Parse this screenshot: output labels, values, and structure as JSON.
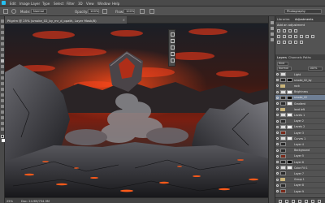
{
  "menubar": {
    "items": [
      "Edit",
      "Image",
      "Layer",
      "Type",
      "Select",
      "Filter",
      "3D",
      "View",
      "Window",
      "Help"
    ]
  },
  "options": {
    "opacity_label": "Opacity:",
    "opacity_value": "100%",
    "flow_label": "Flow:",
    "flow_value": "100%",
    "mode_label": "Mode:",
    "mode_value": "Normal",
    "workspace": "Photography"
  },
  "document": {
    "tab_title": "Pilgrim @ 25% (smoke_02_by_mr_d_opath, Layer Mask/8)",
    "zoom": "25%",
    "doc_size": "Doc: 24.9M/734.9M"
  },
  "right_panel": {
    "top_tabs": [
      "Libraries",
      "Adjustments"
    ],
    "adjust_title": "Add an adjustment",
    "layers_tabs": [
      "Layers",
      "Channels",
      "Paths"
    ],
    "layers_controls": {
      "kind": "Kind",
      "blend": "Normal",
      "opacity": "100%",
      "fill": "100%"
    },
    "layers": [
      {
        "name": "Light",
        "thumb": "light",
        "mask": "none",
        "folder": false,
        "sel": false
      },
      {
        "name": "smoke_02_by",
        "thumb": "dark",
        "mask": "black",
        "folder": false,
        "sel": false
      },
      {
        "name": "rock",
        "thumb": "none",
        "mask": "none",
        "folder": true,
        "sel": false
      },
      {
        "name": "Brightness",
        "thumb": "light",
        "mask": "white",
        "folder": false,
        "sel": false
      },
      {
        "name": "smoke_02",
        "thumb": "dark",
        "mask": "black",
        "folder": false,
        "sel": true
      },
      {
        "name": "Gradient",
        "thumb": "dark",
        "mask": "white",
        "folder": false,
        "sel": false
      },
      {
        "name": "land left",
        "thumb": "none",
        "mask": "none",
        "folder": true,
        "sel": false
      },
      {
        "name": "Levels 1",
        "thumb": "light",
        "mask": "white",
        "folder": false,
        "sel": false
      },
      {
        "name": "Layer 2",
        "thumb": "dark",
        "mask": "none",
        "folder": false,
        "sel": false
      },
      {
        "name": "Levels 2",
        "thumb": "light",
        "mask": "white",
        "folder": false,
        "sel": false
      },
      {
        "name": "Layer 3",
        "thumb": "fire",
        "mask": "none",
        "folder": false,
        "sel": false
      },
      {
        "name": "Curves 1",
        "thumb": "light",
        "mask": "white",
        "folder": false,
        "sel": false
      },
      {
        "name": "Layer 4",
        "thumb": "dark",
        "mask": "none",
        "folder": false,
        "sel": false
      },
      {
        "name": "Background",
        "thumb": "dark",
        "mask": "none",
        "folder": false,
        "sel": false
      },
      {
        "name": "Layer 5",
        "thumb": "fire",
        "mask": "none",
        "folder": false,
        "sel": false
      },
      {
        "name": "Layer 6",
        "thumb": "dark",
        "mask": "black",
        "folder": false,
        "sel": false
      },
      {
        "name": "Color Fill 1",
        "thumb": "light",
        "mask": "white",
        "folder": false,
        "sel": false
      },
      {
        "name": "Layer 7",
        "thumb": "dark",
        "mask": "none",
        "folder": false,
        "sel": false
      },
      {
        "name": "Group 1",
        "thumb": "none",
        "mask": "none",
        "folder": true,
        "sel": false
      },
      {
        "name": "Layer 8",
        "thumb": "dark",
        "mask": "none",
        "folder": false,
        "sel": false
      },
      {
        "name": "Layer 9",
        "thumb": "fire",
        "mask": "none",
        "folder": false,
        "sel": false
      }
    ]
  },
  "colors": {
    "ui_dark": "#3a3a3a",
    "ui_panel": "#535353",
    "selection": "#6f7f95",
    "lava": "#ff3a10"
  }
}
